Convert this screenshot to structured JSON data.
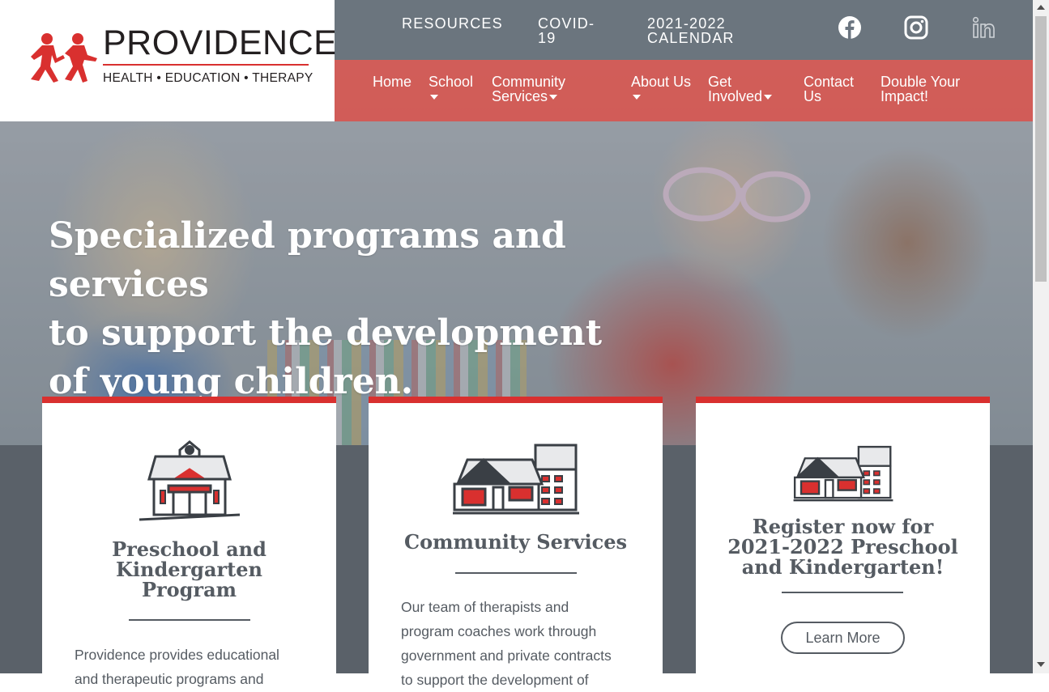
{
  "logo": {
    "title": "PROVIDENCE",
    "subtitle": "HEALTH • EDUCATION • THERAPY",
    "brand_color": "#d9302f"
  },
  "top_links": {
    "resources": "RESOURCES",
    "covid_line1": "COVID-",
    "covid_line2": "19",
    "calendar_line1": "2021-2022",
    "calendar_line2": "CALENDAR"
  },
  "social": {
    "facebook": "facebook-icon",
    "instagram": "instagram-icon",
    "linkedin": "linkedin-icon"
  },
  "nav": {
    "home": "Home",
    "school": "School",
    "community_line1": "Community",
    "community_line2": "Services",
    "about_line1": "About Us",
    "involved_line1": "Get",
    "involved_line2": "Involved",
    "contact_line1": "Contact",
    "contact_line2": "Us",
    "impact_line1": "Double Your",
    "impact_line2": "Impact!"
  },
  "hero": {
    "line1": "Specialized programs and services",
    "line2": "to support the development",
    "line3": "of young children."
  },
  "cards": [
    {
      "title_line1": "Preschool and",
      "title_line2": "Kindergarten",
      "title_line3": "Program",
      "text_line1": "Providence provides educational",
      "text_line2": "and therapeutic programs and"
    },
    {
      "title_line1": "Community Services",
      "text_line1": "Our team of therapists and",
      "text_line2": "program coaches work through",
      "text_line3": "government and private contracts",
      "text_line4": "to support the development of"
    },
    {
      "title_line1": "Register now for",
      "title_line2": "2021-2022 Preschool",
      "title_line3": "and Kindergarten!",
      "button": "Learn More"
    }
  ],
  "colors": {
    "accent_red": "#d9302f",
    "nav_red": "#d75550",
    "slate": "#555b62",
    "topbar_gray": "#646e78"
  }
}
